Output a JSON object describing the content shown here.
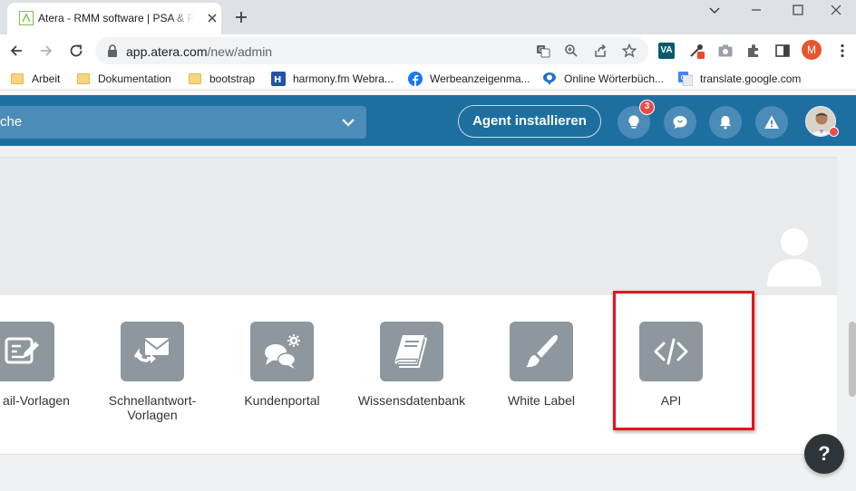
{
  "browser": {
    "tab": {
      "title": "Atera - RMM software | PSA & Remote Access"
    },
    "address": {
      "host": "app.atera.com",
      "path": "/new/admin"
    },
    "profile_initial": "M",
    "extensions": {
      "va_label": "VA"
    },
    "bookmarks": [
      {
        "label": "Arbeit",
        "icon": "folder-icon"
      },
      {
        "label": "Dokumentation",
        "icon": "folder-icon"
      },
      {
        "label": "bootstrap",
        "icon": "folder-icon"
      },
      {
        "label": "harmony.fm Webra...",
        "icon": "harmony-icon"
      },
      {
        "label": "Werbeanzeigenma...",
        "icon": "facebook-icon"
      },
      {
        "label": "Online Wörterbüch...",
        "icon": "dictionary-icon"
      },
      {
        "label": "translate.google.com",
        "icon": "google-translate-icon"
      }
    ]
  },
  "header": {
    "search_text": "che",
    "agent_button": "Agent installieren",
    "notification_badge": "3"
  },
  "admin": {
    "tiles": [
      {
        "label": "ail-Vorlagen",
        "icon": "email-template-edit-icon"
      },
      {
        "label": "Schnellantwort-\nVorlagen",
        "icon": "quick-reply-icon"
      },
      {
        "label": "Kundenportal",
        "icon": "customer-portal-icon"
      },
      {
        "label": "Wissensdatenbank",
        "icon": "knowledge-base-icon"
      },
      {
        "label": "White Label",
        "icon": "paint-brush-icon"
      },
      {
        "label": "API",
        "icon": "code-icon"
      }
    ]
  },
  "help": {
    "label": "?"
  },
  "colors": {
    "header_bg": "#1d6fa0",
    "tile_icon_bg": "#8e979e",
    "highlight": "#e0161e",
    "badge": "#e84a4a"
  }
}
